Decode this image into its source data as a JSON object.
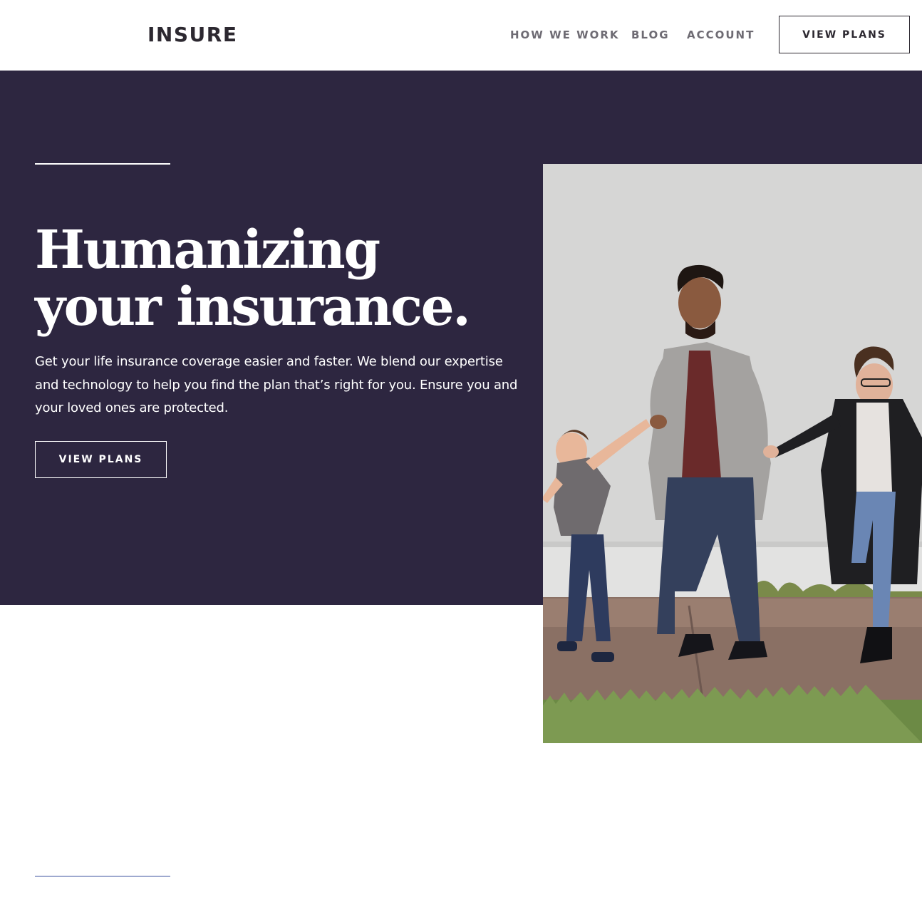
{
  "header": {
    "logo": "INSURE",
    "nav": {
      "how_we_work": "HOW WE WORK",
      "blog": "BLOG",
      "account": "ACCOUNT"
    },
    "cta_label": "VIEW PLANS"
  },
  "hero": {
    "title_line1": "Humanizing",
    "title_line2": "your insurance.",
    "description": "Get your life insurance coverage easier and faster. We blend our expertise and technology to help you find the plan that’s right for you. Ensure you and your loved ones are protected.",
    "cta_label": "VIEW PLANS",
    "image_alt": "family-walking-photo"
  },
  "colors": {
    "hero_bg": "#2d2640",
    "text_dark": "#2c2830",
    "nav_text": "#6e6b73",
    "accent_rule": "#9ea9cf"
  }
}
